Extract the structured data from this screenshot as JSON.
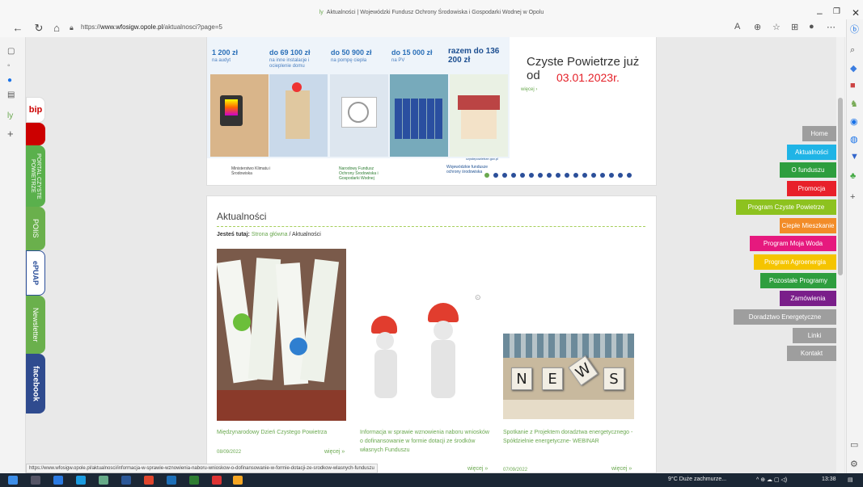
{
  "browser": {
    "title": "Aktualności | Wojewódzki Fundusz Ochrony Środowiska i Gospodarki Wodnej w Opolu",
    "url_prefix": "https://",
    "url_domain": "www.wfosigw.opole.pl",
    "url_path": "/aktualnosci?page=5",
    "status_url": "https://www.wfosigw.opole.pl/aktualnosci/informacja-w-sprawie-wznowienia-naboru-wnioskow-o-dofinansowanie-w-formie-dotacji-ze-srodkow-wlasnych-funduszu"
  },
  "side_tabs": [
    "bip",
    "PORTAL CZYSTE POWIETRZE",
    "POIiS",
    "ePUAP",
    "Newsletter",
    "facebook"
  ],
  "banner": {
    "amounts": [
      {
        "value": "1 200 zł",
        "desc": "na audyt"
      },
      {
        "value": "do 69 100 zł",
        "desc": "na inne instalacje i ocieplenie domu"
      },
      {
        "value": "do 50 900 zł",
        "desc": "na pompę ciepła"
      },
      {
        "value": "do 15 000 zł",
        "desc": "na PV"
      },
      {
        "value": "razem do 136 200 zł",
        "desc": ""
      }
    ],
    "headline": "Czyste Powietrze już od",
    "date": "03.01.2023r.",
    "more": "więcej ›",
    "logos": [
      "Ministerstwo Klimatu i Środowiska",
      "Narodowy Fundusz Ochrony Środowiska i Gospodarki Wodnej",
      "Wojewódzkie fundusze ochrony środowiska"
    ],
    "site": "czystepowietrze.gov.pl"
  },
  "section": {
    "heading": "Aktualności",
    "crumb_label": "Jesteś tutaj:",
    "crumb_home": "Strona główna",
    "crumb_sep": " / ",
    "crumb_current": "Aktualności"
  },
  "news": [
    {
      "title": "Międzynarodowy Dzień Czystego Powietrza",
      "date": "08/09/2022",
      "more": "więcej »"
    },
    {
      "title": "Informacja w sprawie wznowienia naboru wniosków o dofinansowanie w formie dotacji ze środków własnych Funduszu",
      "date": "",
      "more": "więcej »"
    },
    {
      "title": "Spotkanie z Projektem doradztwa energetycznego - Spółdzielnie energetyczne- WEBINAR",
      "date": "07/09/2022",
      "more": "więcej »"
    }
  ],
  "news_image_text": "NEWS",
  "menu": [
    {
      "label": "Home",
      "color": "#9e9e9e"
    },
    {
      "label": "Aktualności",
      "color": "#1fb4e6"
    },
    {
      "label": "O funduszu",
      "color": "#2e9e3e"
    },
    {
      "label": "Promocja",
      "color": "#e8202a"
    },
    {
      "label": "Program Czyste Powietrze",
      "color": "#8dc21f"
    },
    {
      "label": "Ciepłe Mieszkanie",
      "color": "#f28c28"
    },
    {
      "label": "Program Moja Woda",
      "color": "#e6197e"
    },
    {
      "label": "Program Agroenergia",
      "color": "#f5c400"
    },
    {
      "label": "Pozostałe Programy",
      "color": "#2e9e3e"
    },
    {
      "label": "Zamówienia",
      "color": "#7a1f8a"
    },
    {
      "label": "Doradztwo Energetyczne",
      "color": "#9e9e9e"
    },
    {
      "label": "Linki",
      "color": "#9e9e9e"
    },
    {
      "label": "Kontakt",
      "color": "#9e9e9e"
    }
  ],
  "taskbar": {
    "weather": "9°C Duże zachmurze...",
    "time": "13:38"
  }
}
